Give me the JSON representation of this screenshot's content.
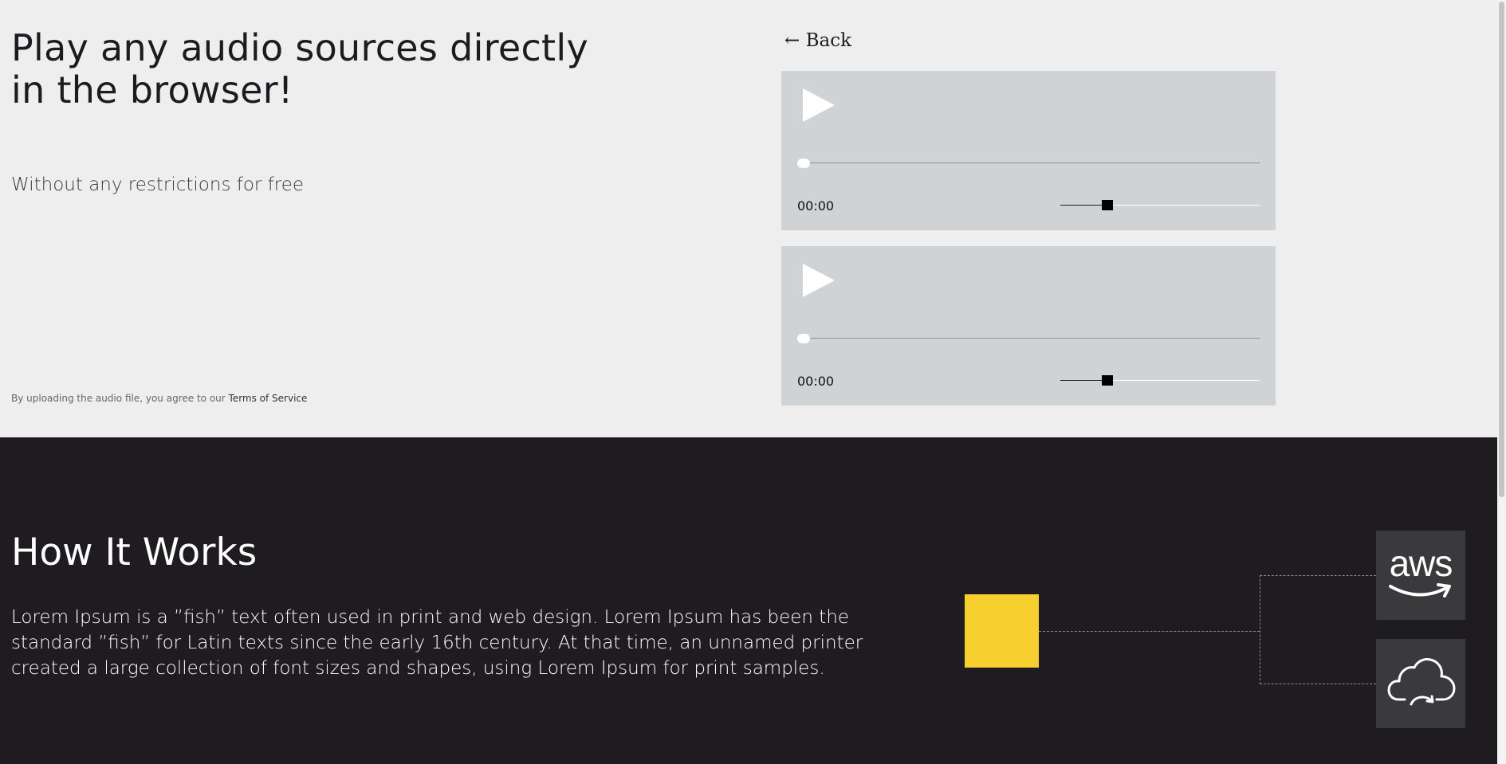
{
  "hero": {
    "title": "Play any audio sources directly in the browser!",
    "subtitle": "Without any restrictions for free",
    "terms_prefix": "By uploading the audio file, you agree to our ",
    "terms_link": "Terms of Service"
  },
  "nav": {
    "back_label": "← Back"
  },
  "players": [
    {
      "time": "00:00",
      "progress": 0,
      "volume": 0.12
    },
    {
      "time": "00:00",
      "progress": 0,
      "volume": 0.12
    }
  ],
  "how_it_works": {
    "title": "How It Works",
    "text": "Lorem Ipsum is a ”fish” text often used in print and web design. Lorem Ipsum has been the standard ”fish” for Latin texts since the early 16th century. At that time, an unnamed printer created a large collection of font sizes and shapes, using Lorem Ipsum for print samples."
  },
  "diagram": {
    "source_color": "#f7cf2f",
    "services": [
      {
        "icon": "aws-logo-icon",
        "text": "aws"
      },
      {
        "icon": "cloud-upload-icon"
      }
    ]
  },
  "colors": {
    "top_background": "#eeeeee",
    "dark_background": "#1e1c1f",
    "player_background": "#cfd3d6",
    "tile_background": "#3a393c"
  }
}
